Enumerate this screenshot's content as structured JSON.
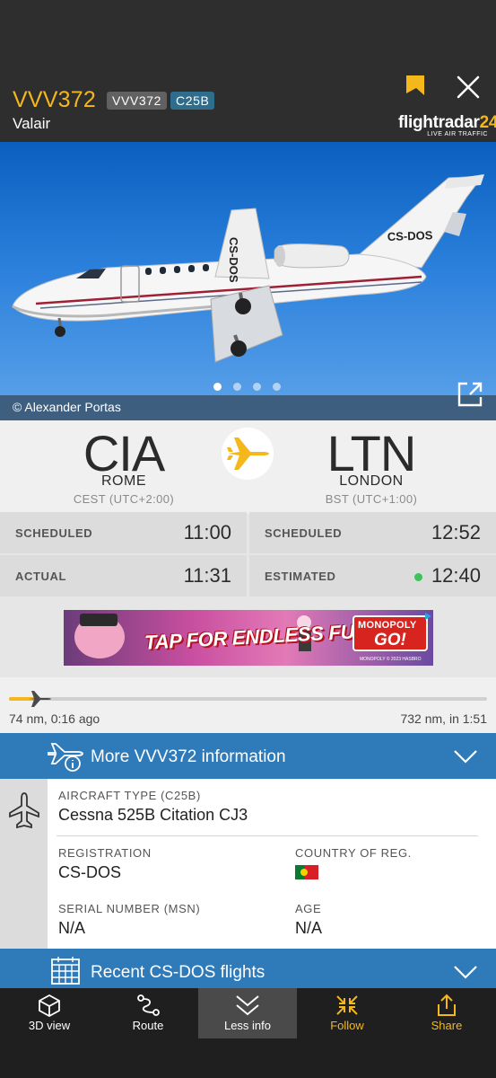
{
  "header": {
    "callsign": "VVV372",
    "badge_callsign": "VVV372",
    "badge_type": "C25B",
    "airline": "Valair",
    "logo_name_a": "flightradar",
    "logo_name_b": "24",
    "logo_tagline": "LIVE AIR TRAFFIC",
    "icons": {
      "bookmark": "bookmark-icon",
      "close": "close-icon"
    }
  },
  "photo": {
    "credit": "© Alexander Portas",
    "registration_marking": "CS-DOS",
    "page_count": 4,
    "active_page": 1
  },
  "route": {
    "origin": {
      "iata": "CIA",
      "city": "ROME",
      "tz": "CEST (UTC+2:00)"
    },
    "destination": {
      "iata": "LTN",
      "city": "LONDON",
      "tz": "BST (UTC+1:00)"
    }
  },
  "times": {
    "dep_scheduled_label": "SCHEDULED",
    "dep_scheduled": "11:00",
    "dep_actual_label": "ACTUAL",
    "dep_actual": "11:31",
    "arr_scheduled_label": "SCHEDULED",
    "arr_scheduled": "12:52",
    "arr_estimated_label": "ESTIMATED",
    "arr_estimated": "12:40"
  },
  "ad": {
    "headline": "TAP FOR ENDLESS FUN!",
    "brand_line1": "MONOPOLY",
    "brand_line2": "GO!",
    "fine_print": "MONOPOLY © 2023 HASBRO"
  },
  "progress": {
    "fraction": 0.06,
    "left_text": "74 nm, 0:16 ago",
    "right_text": "732 nm, in 1:51"
  },
  "more_info": {
    "title": "More VVV372 information"
  },
  "info": {
    "aircraft_type_label": "AIRCRAFT TYPE (C25B)",
    "aircraft_type": "Cessna 525B Citation CJ3",
    "registration_label": "REGISTRATION",
    "registration": "CS-DOS",
    "country_label": "COUNTRY OF REG.",
    "country_flag": "portugal-flag",
    "serial_label": "SERIAL NUMBER (MSN)",
    "serial": "N/A",
    "age_label": "AGE",
    "age": "N/A"
  },
  "recent": {
    "title": "Recent CS-DOS flights"
  },
  "nav": [
    {
      "label": "3D view",
      "icon": "cube-icon"
    },
    {
      "label": "Route",
      "icon": "route-icon"
    },
    {
      "label": "Less info",
      "icon": "chevrons-down-icon"
    },
    {
      "label": "Follow",
      "icon": "follow-icon"
    },
    {
      "label": "Share",
      "icon": "share-icon"
    }
  ],
  "colors": {
    "accent": "#f4b81c",
    "header_bg": "#2e2e2e",
    "bar_blue": "#2f7ab9",
    "badge_blue": "#2e6d8c",
    "status_green": "#3cc45a"
  }
}
